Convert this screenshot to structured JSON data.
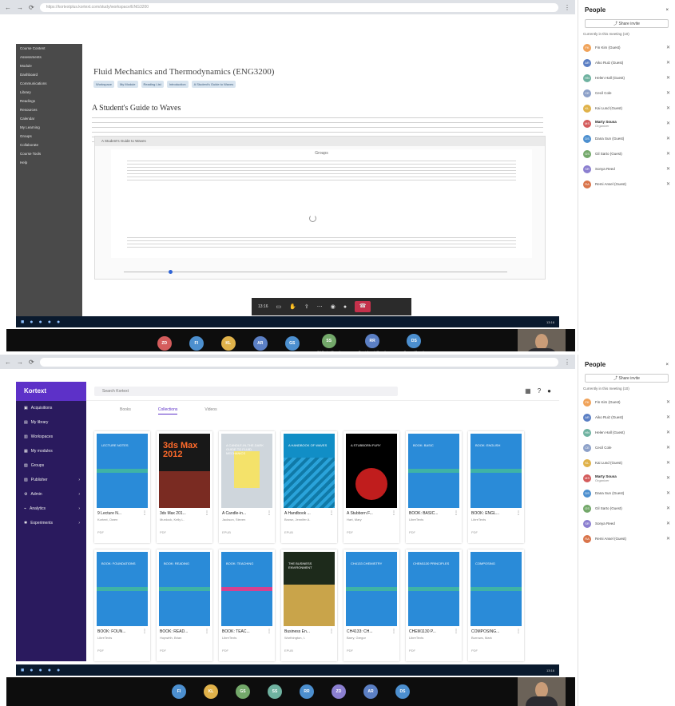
{
  "top": {
    "browser_url": "https://kortextplus.kortext.com/study/workspace/ENG3200",
    "sidebar_items": [
      "Course Content",
      "Assessments",
      "Module",
      "Dashboard",
      "Communications",
      "Library",
      "Readings",
      "Resources",
      "Calendar",
      "My Learning",
      "Groups",
      "Collaborate",
      "Course Tools",
      "Help"
    ],
    "module_title": "Fluid Mechanics and Thermodynamics (ENG3200)",
    "pills": [
      "Workspace",
      "My Module",
      "Reading List",
      "Introduction",
      "A Student's Guide to Waves"
    ],
    "reading_title": "A Student's Guide to Waves",
    "doc_toolbar": "A Student's Guide to Waves",
    "doc_heading": "Groups",
    "teams_time": "13:16"
  },
  "bottom": {
    "kortext_logo": "Kortext",
    "search_placeholder": "Search Kortext",
    "nav": [
      {
        "label": "Acquisitions",
        "arrow": ""
      },
      {
        "label": "My library",
        "arrow": ""
      },
      {
        "label": "Workspaces",
        "arrow": ""
      },
      {
        "label": "My modules",
        "arrow": ""
      },
      {
        "label": "Groups",
        "arrow": ""
      },
      {
        "label": "Publisher",
        "arrow": "›"
      },
      {
        "label": "Admin",
        "arrow": "›"
      },
      {
        "label": "Analytics",
        "arrow": "›"
      },
      {
        "label": "Experiments",
        "arrow": "›"
      }
    ],
    "tabs": [
      "Books",
      "Collections",
      "Videos"
    ],
    "books": [
      {
        "title": "9 Lecture N...",
        "author": "Kortext, Owen",
        "format": "PDF",
        "cover_text": "LECTURE NOTES"
      },
      {
        "title": "3ds Max 201...",
        "author": "Murdock, Kelly L.",
        "format": "PDF",
        "cover_text": "3ds Max 2012"
      },
      {
        "title": "A Candle-in...",
        "author": "Jackson, Steven",
        "format": "EPUB",
        "cover_text": "A CANDLE-IN-THE-DARK GUIDE TO FLUID MECHANICS"
      },
      {
        "title": "A Handbook ...",
        "author": "Brown, Jennifer A.",
        "format": "EPUB",
        "cover_text": "A HANDBOOK OF WAVES"
      },
      {
        "title": "A Stubborn F...",
        "author": "Hart, Mary",
        "format": "PDF",
        "cover_text": "A STUBBORN FURY"
      },
      {
        "title": "BOOK: BASIC...",
        "author": "LibreTexts",
        "format": "PDF",
        "cover_text": "BOOK: BASIC"
      },
      {
        "title": "BOOK: ENGL...",
        "author": "LibreTexts",
        "format": "PDF",
        "cover_text": "BOOK: ENGLISH"
      },
      {
        "title": "BOOK: FOUN...",
        "author": "LibreTexts",
        "format": "PDF",
        "cover_text": "BOOK: FOUNDATIONS"
      },
      {
        "title": "BOOK: READ...",
        "author": "Hopwirth, Brian",
        "format": "PDF",
        "cover_text": "BOOK: READING"
      },
      {
        "title": "BOOK: TEAC...",
        "author": "LibreTexts",
        "format": "PDF",
        "cover_text": "BOOK: TEACHING"
      },
      {
        "title": "Business En...",
        "author": "Worthington, I.",
        "format": "EPUB",
        "cover_text": "THE BUSINESS ENVIRONMENT"
      },
      {
        "title": "CH4133: CH...",
        "author": "Barry, Gregor",
        "format": "PDF",
        "cover_text": "CH4133 CHEMISTRY"
      },
      {
        "title": "CHEM1130 P...",
        "author": "LibreTexts",
        "format": "PDF",
        "cover_text": "CHEM1130 PRINCIPLES"
      },
      {
        "title": "COMPOSING...",
        "author": "Burrows, Mark",
        "format": "PDF",
        "cover_text": "COMPOSING"
      }
    ]
  },
  "people": {
    "title": "People",
    "share": "Share invite",
    "note": "Currently in this meeting (10)",
    "list": [
      {
        "initials": "FK",
        "name": "Fin Kim (Guest)",
        "sub": "",
        "color": "#f0a35a"
      },
      {
        "initials": "AR",
        "name": "Aiko Ruiz (Guest)",
        "sub": "",
        "color": "#5b7fc4"
      },
      {
        "initials": "HN",
        "name": "Helen Hall (Guest)",
        "sub": "",
        "color": "#6fb2a0"
      },
      {
        "initials": "CE",
        "name": "Cecil Cole",
        "sub": "",
        "color": "#8ca0c8"
      },
      {
        "initials": "KL",
        "name": "Kai Lund (Guest)",
        "sub": "",
        "color": "#e0b24a"
      },
      {
        "initials": "MS",
        "name": "Marty Sousa",
        "sub": "Organizer",
        "color": "#d45c5c"
      },
      {
        "initials": "DS",
        "name": "Dana Sun (Guest)",
        "sub": "",
        "color": "#4c8fcf"
      },
      {
        "initials": "GS",
        "name": "Gil Sarto (Guest)",
        "sub": "",
        "color": "#73a86a"
      },
      {
        "initials": "SR",
        "name": "Sonya Reed",
        "sub": "",
        "color": "#8b7fd0"
      },
      {
        "initials": "RA",
        "name": "Remi Ansel (Guest)",
        "sub": "",
        "color": "#d9744a"
      }
    ]
  },
  "video_strip_top": [
    {
      "initials": "ZD",
      "name": "",
      "color": "#d45c5c"
    },
    {
      "initials": "FI",
      "name": "",
      "color": "#4c8fcf"
    },
    {
      "initials": "KL",
      "name": "",
      "color": "#e0b24a"
    },
    {
      "initials": "AR",
      "name": "",
      "color": "#5b7fc4"
    },
    {
      "initials": "GS",
      "name": "",
      "color": "#4c8fcf"
    },
    {
      "initials": "SS",
      "name": "Gil Sarto (Guest)",
      "color": "#73a86a"
    },
    {
      "initials": "RR",
      "name": "Remi Ansel (Guest)",
      "color": "#5b7fc4"
    },
    {
      "initials": "DS",
      "name": "Sonya (Guest)",
      "color": "#4c8fcf"
    }
  ],
  "video_strip_bottom": [
    {
      "initials": "FI",
      "name": "",
      "color": "#4c8fcf"
    },
    {
      "initials": "KL",
      "name": "",
      "color": "#e0b24a"
    },
    {
      "initials": "GS",
      "name": "",
      "color": "#73a86a"
    },
    {
      "initials": "SS",
      "name": "",
      "color": "#6fb2a0"
    },
    {
      "initials": "RR",
      "name": "",
      "color": "#4c8fcf"
    },
    {
      "initials": "ZD",
      "name": "",
      "color": "#8b7fd0"
    },
    {
      "initials": "AR",
      "name": "",
      "color": "#5b7fc4"
    },
    {
      "initials": "DS",
      "name": "",
      "color": "#4c8fcf"
    }
  ],
  "clock": "13:16"
}
